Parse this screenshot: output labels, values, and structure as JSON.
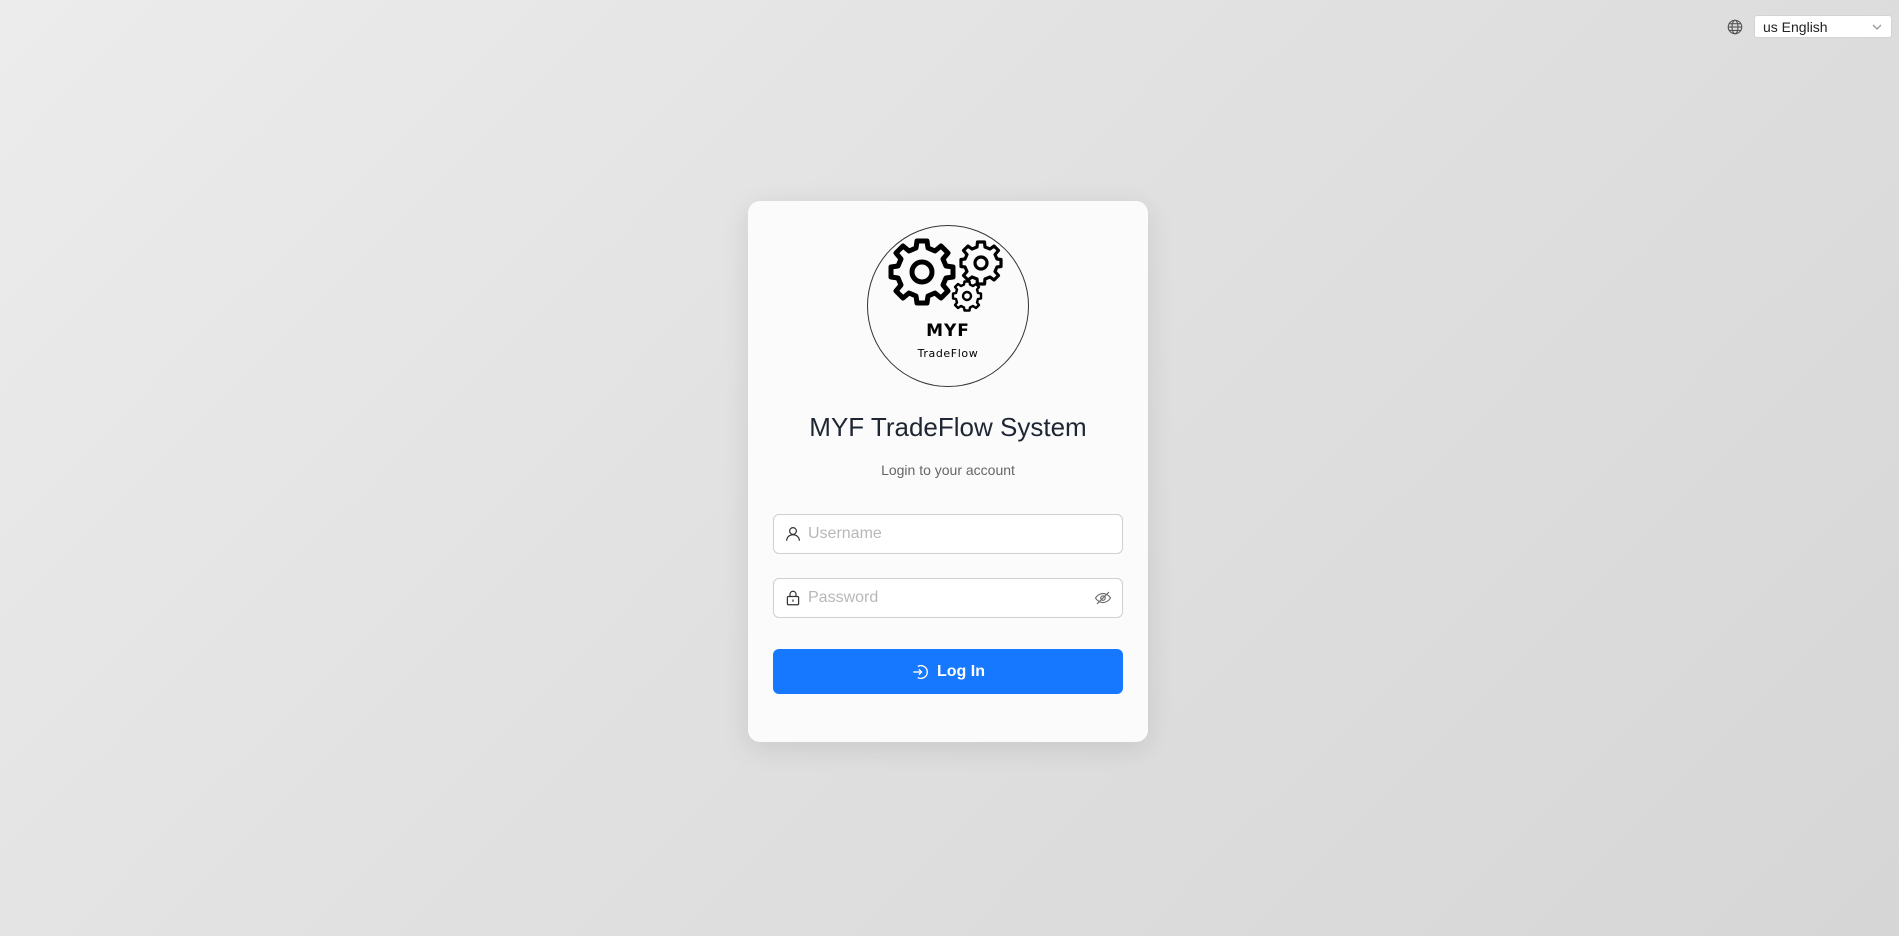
{
  "language": {
    "icon": "globe-icon",
    "selected": "us English",
    "chevron_icon": "chevron-down-icon"
  },
  "logo": {
    "icon": "gears-icon",
    "line1": "MYF",
    "line2": "TradeFlow"
  },
  "title": "MYF TradeFlow System",
  "subtitle": "Login to your account",
  "username": {
    "icon": "user-icon",
    "placeholder": "Username",
    "value": ""
  },
  "password": {
    "icon": "lock-icon",
    "placeholder": "Password",
    "value": "",
    "toggle_icon": "eye-slash-icon"
  },
  "login_button": {
    "icon": "login-icon",
    "label": "Log In",
    "color": "#1677ff"
  }
}
